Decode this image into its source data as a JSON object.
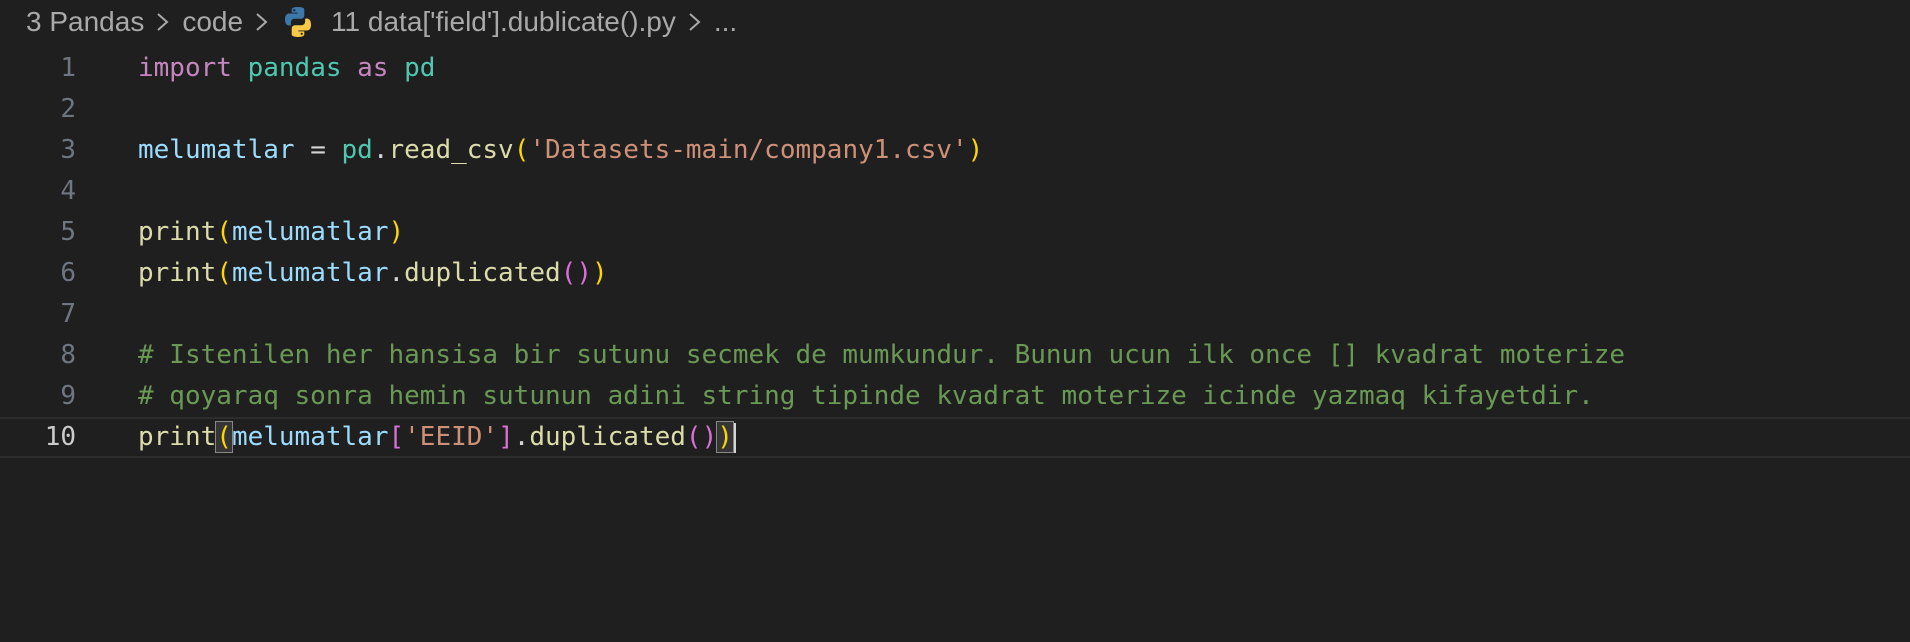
{
  "breadcrumb": {
    "items": [
      "3 Pandas",
      "code",
      "11 data['field'].dublicate().py",
      "..."
    ],
    "file_icon": "python-icon",
    "separator_icon": "chevron-right-icon"
  },
  "editor": {
    "current_line": 10,
    "lines": [
      {
        "number": "1",
        "tokens": [
          {
            "t": "import",
            "c": "kw"
          },
          {
            "t": " ",
            "c": "op"
          },
          {
            "t": "pandas",
            "c": "mod"
          },
          {
            "t": " ",
            "c": "op"
          },
          {
            "t": "as",
            "c": "kw"
          },
          {
            "t": " ",
            "c": "op"
          },
          {
            "t": "pd",
            "c": "mod"
          }
        ]
      },
      {
        "number": "2",
        "tokens": []
      },
      {
        "number": "3",
        "tokens": [
          {
            "t": "melumatlar",
            "c": "var"
          },
          {
            "t": " = ",
            "c": "op"
          },
          {
            "t": "pd",
            "c": "mod"
          },
          {
            "t": ".",
            "c": "op"
          },
          {
            "t": "read_csv",
            "c": "fn"
          },
          {
            "t": "(",
            "c": "br1"
          },
          {
            "t": "'Datasets-main/company1.csv'",
            "c": "str"
          },
          {
            "t": ")",
            "c": "br1"
          }
        ]
      },
      {
        "number": "4",
        "tokens": []
      },
      {
        "number": "5",
        "tokens": [
          {
            "t": "print",
            "c": "fn"
          },
          {
            "t": "(",
            "c": "br1"
          },
          {
            "t": "melumatlar",
            "c": "var"
          },
          {
            "t": ")",
            "c": "br1"
          }
        ]
      },
      {
        "number": "6",
        "tokens": [
          {
            "t": "print",
            "c": "fn"
          },
          {
            "t": "(",
            "c": "br1"
          },
          {
            "t": "melumatlar",
            "c": "var"
          },
          {
            "t": ".",
            "c": "op"
          },
          {
            "t": "duplicated",
            "c": "fn"
          },
          {
            "t": "()",
            "c": "br2"
          },
          {
            "t": ")",
            "c": "br1"
          }
        ]
      },
      {
        "number": "7",
        "tokens": []
      },
      {
        "number": "8",
        "tokens": [
          {
            "t": "# Istenilen her hansisa bir sutunu secmek de mumkundur. Bunun ucun ilk once [] kvadrat moterize",
            "c": "cmt"
          }
        ]
      },
      {
        "number": "9",
        "tokens": [
          {
            "t": "# qoyaraq sonra hemin sutunun adini string tipinde kvadrat moterize icinde yazmaq kifayetdir.",
            "c": "cmt"
          }
        ]
      },
      {
        "number": "10",
        "tokens": [
          {
            "t": "print",
            "c": "fn"
          },
          {
            "t": "(",
            "c": "br1",
            "m": true
          },
          {
            "t": "melumatlar",
            "c": "var"
          },
          {
            "t": "[",
            "c": "br2"
          },
          {
            "t": "'EEID'",
            "c": "str"
          },
          {
            "t": "]",
            "c": "br2"
          },
          {
            "t": ".",
            "c": "op"
          },
          {
            "t": "duplicated",
            "c": "fn"
          },
          {
            "t": "()",
            "c": "br2"
          },
          {
            "t": ")",
            "c": "br1",
            "m": true
          }
        ]
      }
    ]
  }
}
